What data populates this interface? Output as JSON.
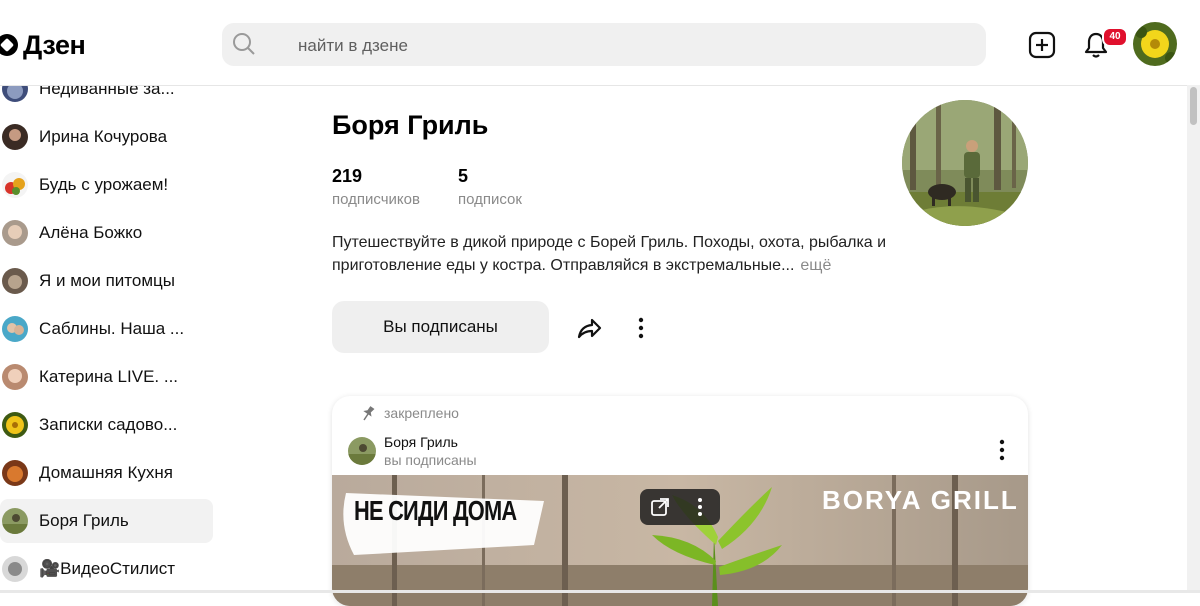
{
  "header": {
    "logo_text": "Дзен",
    "search_placeholder": "найти в дзене",
    "notification_count": "40"
  },
  "sidebar": {
    "items": [
      {
        "label": "Недиванные за...",
        "active": false
      },
      {
        "label": "Ирина Кочурова",
        "active": false
      },
      {
        "label": "Будь с урожаем!",
        "active": false
      },
      {
        "label": "Алёна Божко",
        "active": false
      },
      {
        "label": "Я и мои питомцы",
        "active": false
      },
      {
        "label": "Саблины. Наша ...",
        "active": false
      },
      {
        "label": "Катерина LIVE. ...",
        "active": false
      },
      {
        "label": "Записки садово...",
        "active": false
      },
      {
        "label": "Домашняя Кухня",
        "active": false
      },
      {
        "label": "Боря Гриль",
        "active": true
      },
      {
        "label": "🎥ВидеоСтилист",
        "active": false
      }
    ]
  },
  "channel": {
    "title": "Боря Гриль",
    "subscribers_count": "219",
    "subscribers_label": "подписчиков",
    "subscriptions_count": "5",
    "subscriptions_label": "подписок",
    "description": "Путешествуйте в дикой природе с Борей Гриль. Походы, охота, рыбалка и приготовление еды у костра. Отправляйся в экстремальные...",
    "more_label": "ещё",
    "subscribed_button": "Вы подписаны"
  },
  "post": {
    "pinned_label": "закреплено",
    "author": "Боря Гриль",
    "status": "вы подписаны",
    "banner_text": "НЕ СИДИ ДОМА",
    "banner_brand": "BORYA GRILL"
  },
  "colors": {
    "accent_badge": "#e0102d",
    "button_bg": "#efefef",
    "active_item_bg": "#f2f2f2"
  }
}
